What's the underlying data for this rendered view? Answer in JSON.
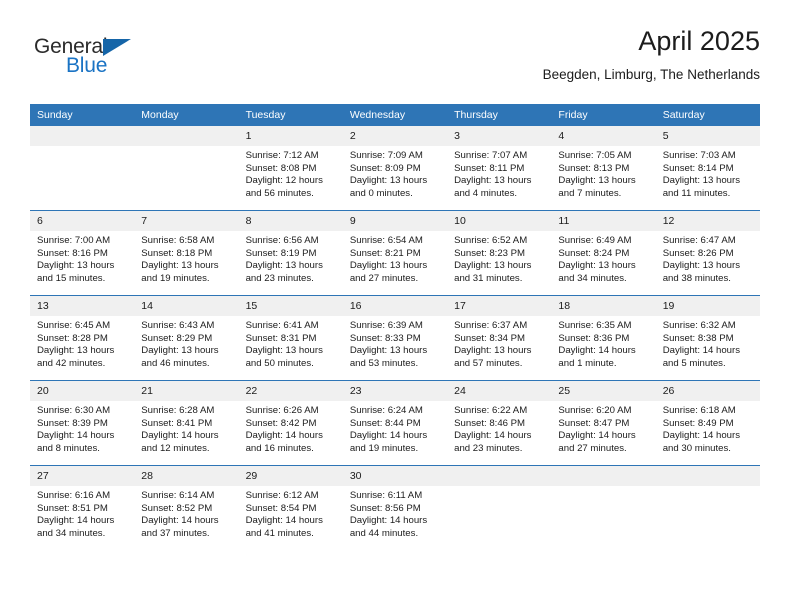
{
  "brand": {
    "line1": "General",
    "line2": "Blue",
    "triangle_icon": "triangle-icon",
    "color_text": "#2b2b2b",
    "color_blue": "#1a73c4"
  },
  "header": {
    "title": "April 2025",
    "subtitle": "Beegden, Limburg, The Netherlands"
  },
  "theme": {
    "header_bg": "#2e75b6",
    "daynum_bg": "#f0f0f0",
    "cell_bg": "#ffffff",
    "row_border": "#2e75b6"
  },
  "calendar": {
    "weekday_headers": [
      "Sunday",
      "Monday",
      "Tuesday",
      "Wednesday",
      "Thursday",
      "Friday",
      "Saturday"
    ],
    "weeks": [
      [
        {
          "day": "",
          "sunrise": "",
          "sunset": "",
          "daylight": "",
          "daylight2": ""
        },
        {
          "day": "",
          "sunrise": "",
          "sunset": "",
          "daylight": "",
          "daylight2": ""
        },
        {
          "day": "1",
          "sunrise": "Sunrise: 7:12 AM",
          "sunset": "Sunset: 8:08 PM",
          "daylight": "Daylight: 12 hours",
          "daylight2": "and 56 minutes."
        },
        {
          "day": "2",
          "sunrise": "Sunrise: 7:09 AM",
          "sunset": "Sunset: 8:09 PM",
          "daylight": "Daylight: 13 hours",
          "daylight2": "and 0 minutes."
        },
        {
          "day": "3",
          "sunrise": "Sunrise: 7:07 AM",
          "sunset": "Sunset: 8:11 PM",
          "daylight": "Daylight: 13 hours",
          "daylight2": "and 4 minutes."
        },
        {
          "day": "4",
          "sunrise": "Sunrise: 7:05 AM",
          "sunset": "Sunset: 8:13 PM",
          "daylight": "Daylight: 13 hours",
          "daylight2": "and 7 minutes."
        },
        {
          "day": "5",
          "sunrise": "Sunrise: 7:03 AM",
          "sunset": "Sunset: 8:14 PM",
          "daylight": "Daylight: 13 hours",
          "daylight2": "and 11 minutes."
        }
      ],
      [
        {
          "day": "6",
          "sunrise": "Sunrise: 7:00 AM",
          "sunset": "Sunset: 8:16 PM",
          "daylight": "Daylight: 13 hours",
          "daylight2": "and 15 minutes."
        },
        {
          "day": "7",
          "sunrise": "Sunrise: 6:58 AM",
          "sunset": "Sunset: 8:18 PM",
          "daylight": "Daylight: 13 hours",
          "daylight2": "and 19 minutes."
        },
        {
          "day": "8",
          "sunrise": "Sunrise: 6:56 AM",
          "sunset": "Sunset: 8:19 PM",
          "daylight": "Daylight: 13 hours",
          "daylight2": "and 23 minutes."
        },
        {
          "day": "9",
          "sunrise": "Sunrise: 6:54 AM",
          "sunset": "Sunset: 8:21 PM",
          "daylight": "Daylight: 13 hours",
          "daylight2": "and 27 minutes."
        },
        {
          "day": "10",
          "sunrise": "Sunrise: 6:52 AM",
          "sunset": "Sunset: 8:23 PM",
          "daylight": "Daylight: 13 hours",
          "daylight2": "and 31 minutes."
        },
        {
          "day": "11",
          "sunrise": "Sunrise: 6:49 AM",
          "sunset": "Sunset: 8:24 PM",
          "daylight": "Daylight: 13 hours",
          "daylight2": "and 34 minutes."
        },
        {
          "day": "12",
          "sunrise": "Sunrise: 6:47 AM",
          "sunset": "Sunset: 8:26 PM",
          "daylight": "Daylight: 13 hours",
          "daylight2": "and 38 minutes."
        }
      ],
      [
        {
          "day": "13",
          "sunrise": "Sunrise: 6:45 AM",
          "sunset": "Sunset: 8:28 PM",
          "daylight": "Daylight: 13 hours",
          "daylight2": "and 42 minutes."
        },
        {
          "day": "14",
          "sunrise": "Sunrise: 6:43 AM",
          "sunset": "Sunset: 8:29 PM",
          "daylight": "Daylight: 13 hours",
          "daylight2": "and 46 minutes."
        },
        {
          "day": "15",
          "sunrise": "Sunrise: 6:41 AM",
          "sunset": "Sunset: 8:31 PM",
          "daylight": "Daylight: 13 hours",
          "daylight2": "and 50 minutes."
        },
        {
          "day": "16",
          "sunrise": "Sunrise: 6:39 AM",
          "sunset": "Sunset: 8:33 PM",
          "daylight": "Daylight: 13 hours",
          "daylight2": "and 53 minutes."
        },
        {
          "day": "17",
          "sunrise": "Sunrise: 6:37 AM",
          "sunset": "Sunset: 8:34 PM",
          "daylight": "Daylight: 13 hours",
          "daylight2": "and 57 minutes."
        },
        {
          "day": "18",
          "sunrise": "Sunrise: 6:35 AM",
          "sunset": "Sunset: 8:36 PM",
          "daylight": "Daylight: 14 hours",
          "daylight2": "and 1 minute."
        },
        {
          "day": "19",
          "sunrise": "Sunrise: 6:32 AM",
          "sunset": "Sunset: 8:38 PM",
          "daylight": "Daylight: 14 hours",
          "daylight2": "and 5 minutes."
        }
      ],
      [
        {
          "day": "20",
          "sunrise": "Sunrise: 6:30 AM",
          "sunset": "Sunset: 8:39 PM",
          "daylight": "Daylight: 14 hours",
          "daylight2": "and 8 minutes."
        },
        {
          "day": "21",
          "sunrise": "Sunrise: 6:28 AM",
          "sunset": "Sunset: 8:41 PM",
          "daylight": "Daylight: 14 hours",
          "daylight2": "and 12 minutes."
        },
        {
          "day": "22",
          "sunrise": "Sunrise: 6:26 AM",
          "sunset": "Sunset: 8:42 PM",
          "daylight": "Daylight: 14 hours",
          "daylight2": "and 16 minutes."
        },
        {
          "day": "23",
          "sunrise": "Sunrise: 6:24 AM",
          "sunset": "Sunset: 8:44 PM",
          "daylight": "Daylight: 14 hours",
          "daylight2": "and 19 minutes."
        },
        {
          "day": "24",
          "sunrise": "Sunrise: 6:22 AM",
          "sunset": "Sunset: 8:46 PM",
          "daylight": "Daylight: 14 hours",
          "daylight2": "and 23 minutes."
        },
        {
          "day": "25",
          "sunrise": "Sunrise: 6:20 AM",
          "sunset": "Sunset: 8:47 PM",
          "daylight": "Daylight: 14 hours",
          "daylight2": "and 27 minutes."
        },
        {
          "day": "26",
          "sunrise": "Sunrise: 6:18 AM",
          "sunset": "Sunset: 8:49 PM",
          "daylight": "Daylight: 14 hours",
          "daylight2": "and 30 minutes."
        }
      ],
      [
        {
          "day": "27",
          "sunrise": "Sunrise: 6:16 AM",
          "sunset": "Sunset: 8:51 PM",
          "daylight": "Daylight: 14 hours",
          "daylight2": "and 34 minutes."
        },
        {
          "day": "28",
          "sunrise": "Sunrise: 6:14 AM",
          "sunset": "Sunset: 8:52 PM",
          "daylight": "Daylight: 14 hours",
          "daylight2": "and 37 minutes."
        },
        {
          "day": "29",
          "sunrise": "Sunrise: 6:12 AM",
          "sunset": "Sunset: 8:54 PM",
          "daylight": "Daylight: 14 hours",
          "daylight2": "and 41 minutes."
        },
        {
          "day": "30",
          "sunrise": "Sunrise: 6:11 AM",
          "sunset": "Sunset: 8:56 PM",
          "daylight": "Daylight: 14 hours",
          "daylight2": "and 44 minutes."
        },
        {
          "day": "",
          "sunrise": "",
          "sunset": "",
          "daylight": "",
          "daylight2": ""
        },
        {
          "day": "",
          "sunrise": "",
          "sunset": "",
          "daylight": "",
          "daylight2": ""
        },
        {
          "day": "",
          "sunrise": "",
          "sunset": "",
          "daylight": "",
          "daylight2": ""
        }
      ]
    ]
  }
}
